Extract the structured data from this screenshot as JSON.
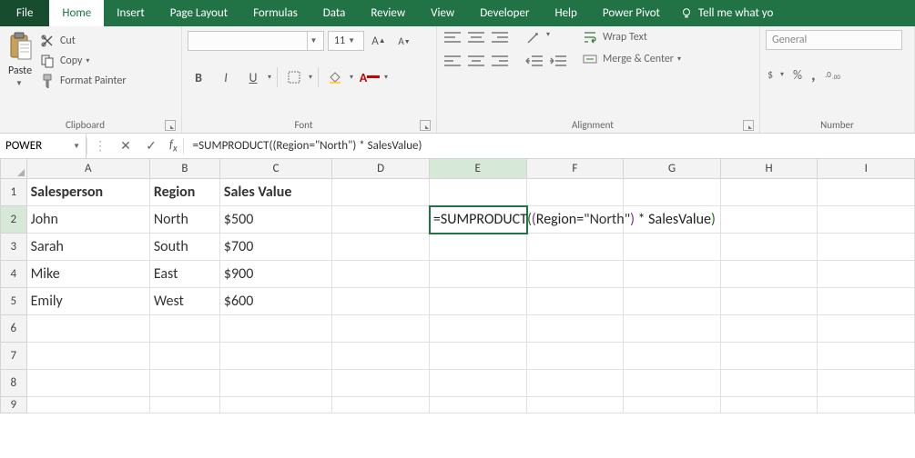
{
  "ribbon": {
    "tabs": [
      "File",
      "Home",
      "Insert",
      "Page Layout",
      "Formulas",
      "Data",
      "Review",
      "View",
      "Developer",
      "Help",
      "Power Pivot"
    ],
    "active_tab": "Home",
    "tell_me": "Tell me what yo"
  },
  "clipboard": {
    "group_label": "Clipboard",
    "paste": "Paste",
    "cut": "Cut",
    "copy": "Copy",
    "format_painter": "Format Painter"
  },
  "font": {
    "group_label": "Font",
    "font_name": "",
    "font_size": "11",
    "bold": "B",
    "italic": "I",
    "underline": "U"
  },
  "alignment": {
    "group_label": "Alignment",
    "wrap_text": "Wrap Text",
    "merge_center": "Merge & Center"
  },
  "number": {
    "group_label": "Number",
    "format": "General",
    "percent": "%",
    "comma": ","
  },
  "formula_bar": {
    "name_box": "POWER",
    "formula_plain": "=SUMPRODUCT((Region=\"North\") * SalesValue)"
  },
  "grid": {
    "columns": [
      "A",
      "B",
      "C",
      "D",
      "E",
      "F",
      "G",
      "H",
      "I"
    ],
    "selected_column": "E",
    "selected_row": 2,
    "headers": {
      "A": "Salesperson",
      "B": "Region",
      "C": "Sales Value"
    },
    "rows": [
      {
        "A": "John",
        "B": "North",
        "C": "$500"
      },
      {
        "A": "Sarah",
        "B": "South",
        "C": "$700"
      },
      {
        "A": "Mike",
        "B": "East",
        "C": "$900"
      },
      {
        "A": "Emily",
        "B": "West",
        "C": "$600"
      }
    ],
    "formula_cell": {
      "prefix": "=SUMPRODUCT",
      "p1o": "(",
      "p2o": "(",
      "mid1": "Region=",
      "str": "\"North\"",
      "p2c": ")",
      "mid2": " * SalesValue",
      "p1c": ")"
    },
    "visible_row_count": 9
  }
}
